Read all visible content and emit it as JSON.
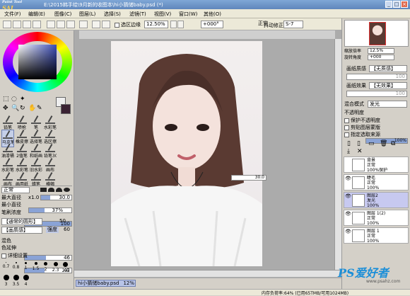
{
  "titlebar": {
    "logo_a": "Paint Tool",
    "logo_b": "SAI",
    "title": "E:\\2015韩手绘\\9月新的收图本\\hi小猜储baby.psd (*)",
    "btn_min": "_",
    "btn_max": "□",
    "btn_close": "×"
  },
  "menu": [
    "文件(F)",
    "编辑(E)",
    "图像(C)",
    "图层(L)",
    "选择(S)",
    "滤镜(T)",
    "视图(V)",
    "窗口(W)",
    "其他(O)"
  ],
  "toolbar": {
    "selection_edge": "选区边缘",
    "zoom": "12.50%",
    "rotation": "+000°",
    "blend": "正常",
    "stabilizer_label": "抖动修正",
    "stabilizer": "S-7"
  },
  "tools": [
    [
      {
        "l": "铅笔",
        "s": false
      },
      {
        "l": "喷枪",
        "s": false
      },
      {
        "l": "笔",
        "s": false
      },
      {
        "l": "水彩笔",
        "s": false
      }
    ],
    [
      {
        "l": "马克笔",
        "s": true
      },
      {
        "l": "橡皮擦",
        "s": false
      },
      {
        "l": "选择笔",
        "s": false
      },
      {
        "l": "选区擦",
        "s": false
      }
    ],
    [
      {
        "l": "油漆桶",
        "s": false
      },
      {
        "l": "2值笔",
        "s": false
      },
      {
        "l": "和纸画",
        "s": false
      },
      {
        "l": "铅笔30",
        "s": false
      }
    ],
    [
      {
        "l": "水彩笔",
        "s": false
      },
      {
        "l": "水彩笔",
        "s": false
      },
      {
        "l": "旧水彩",
        "s": false
      },
      {
        "l": "画布",
        "s": false
      }
    ],
    [
      {
        "l": "画布",
        "s": false
      },
      {
        "l": "画用纸",
        "s": false
      },
      {
        "l": "蜡笔",
        "s": false
      },
      {
        "l": "横幅",
        "s": false
      }
    ]
  ],
  "brush": {
    "mode": "正常",
    "max_diameter_label": "最大直径",
    "max_diameter_mult": "x1.0",
    "max_diameter": "30.0",
    "min_diameter_label": "最小直径",
    "min_diameter": "37%",
    "min_diameter_frac": 0.37,
    "density_label": "笔刷浓度",
    "density": "100",
    "density_frac": 1.0,
    "shape": "【通常的圆形】",
    "shape_val": "50",
    "texture": "【画质感】",
    "strength_label": "强度",
    "strength": "60",
    "mix_label": "混色",
    "mix": "46",
    "mix_frac": 0.46,
    "water_label": "色延伸",
    "water": "43",
    "water_frac": 0.43,
    "detail_label": "详细设置",
    "sizes": [
      "0.7",
      "0.8",
      "1",
      "1.5",
      "2",
      "2.3",
      "2.6",
      "3",
      "3.5",
      "4"
    ]
  },
  "canvas": {
    "size_popup": "30.0",
    "tab_label": "hi小猜储baby.psd",
    "tab_zoom": "12%"
  },
  "right": {
    "zoom_label": "缩放倍率",
    "zoom": "12.5%",
    "angle_label": "旋转角度",
    "angle": "+000",
    "paper_label": "画纸质感",
    "paper": "【无质感】",
    "paper_strength": "100",
    "effect_label": "画纸效果",
    "effect": "【无效果】",
    "effect_strength": "100",
    "blend_label": "混合模式",
    "blend": "发光",
    "opacity_label": "不透明度",
    "opacity": "100%",
    "opt1": "保护不透明度",
    "opt2": "剪贴图层蒙版",
    "opt3": "指定选取来源",
    "layers": [
      {
        "n1": "背景",
        "n2": "正常",
        "n3": "100%保护",
        "eye": "",
        "sel": false
      },
      {
        "n1": "睫毛",
        "n2": "正常",
        "n3": "100%",
        "eye": "👁",
        "sel": false
      },
      {
        "n1": "图层2",
        "n2": "发光",
        "n3": "100%",
        "eye": "👁",
        "sel": true
      },
      {
        "n1": "图层 1(2)",
        "n2": "正常",
        "n3": "100%",
        "eye": "👁",
        "sel": false
      },
      {
        "n1": "图层 1",
        "n2": "正常",
        "n3": "100%",
        "eye": "👁",
        "sel": false
      }
    ]
  },
  "status": {
    "memory": "内存负荷率:64% (已用65TMB/可用1024MB)",
    "brand": "PS爱好者",
    "url": "www.psahz.com"
  }
}
